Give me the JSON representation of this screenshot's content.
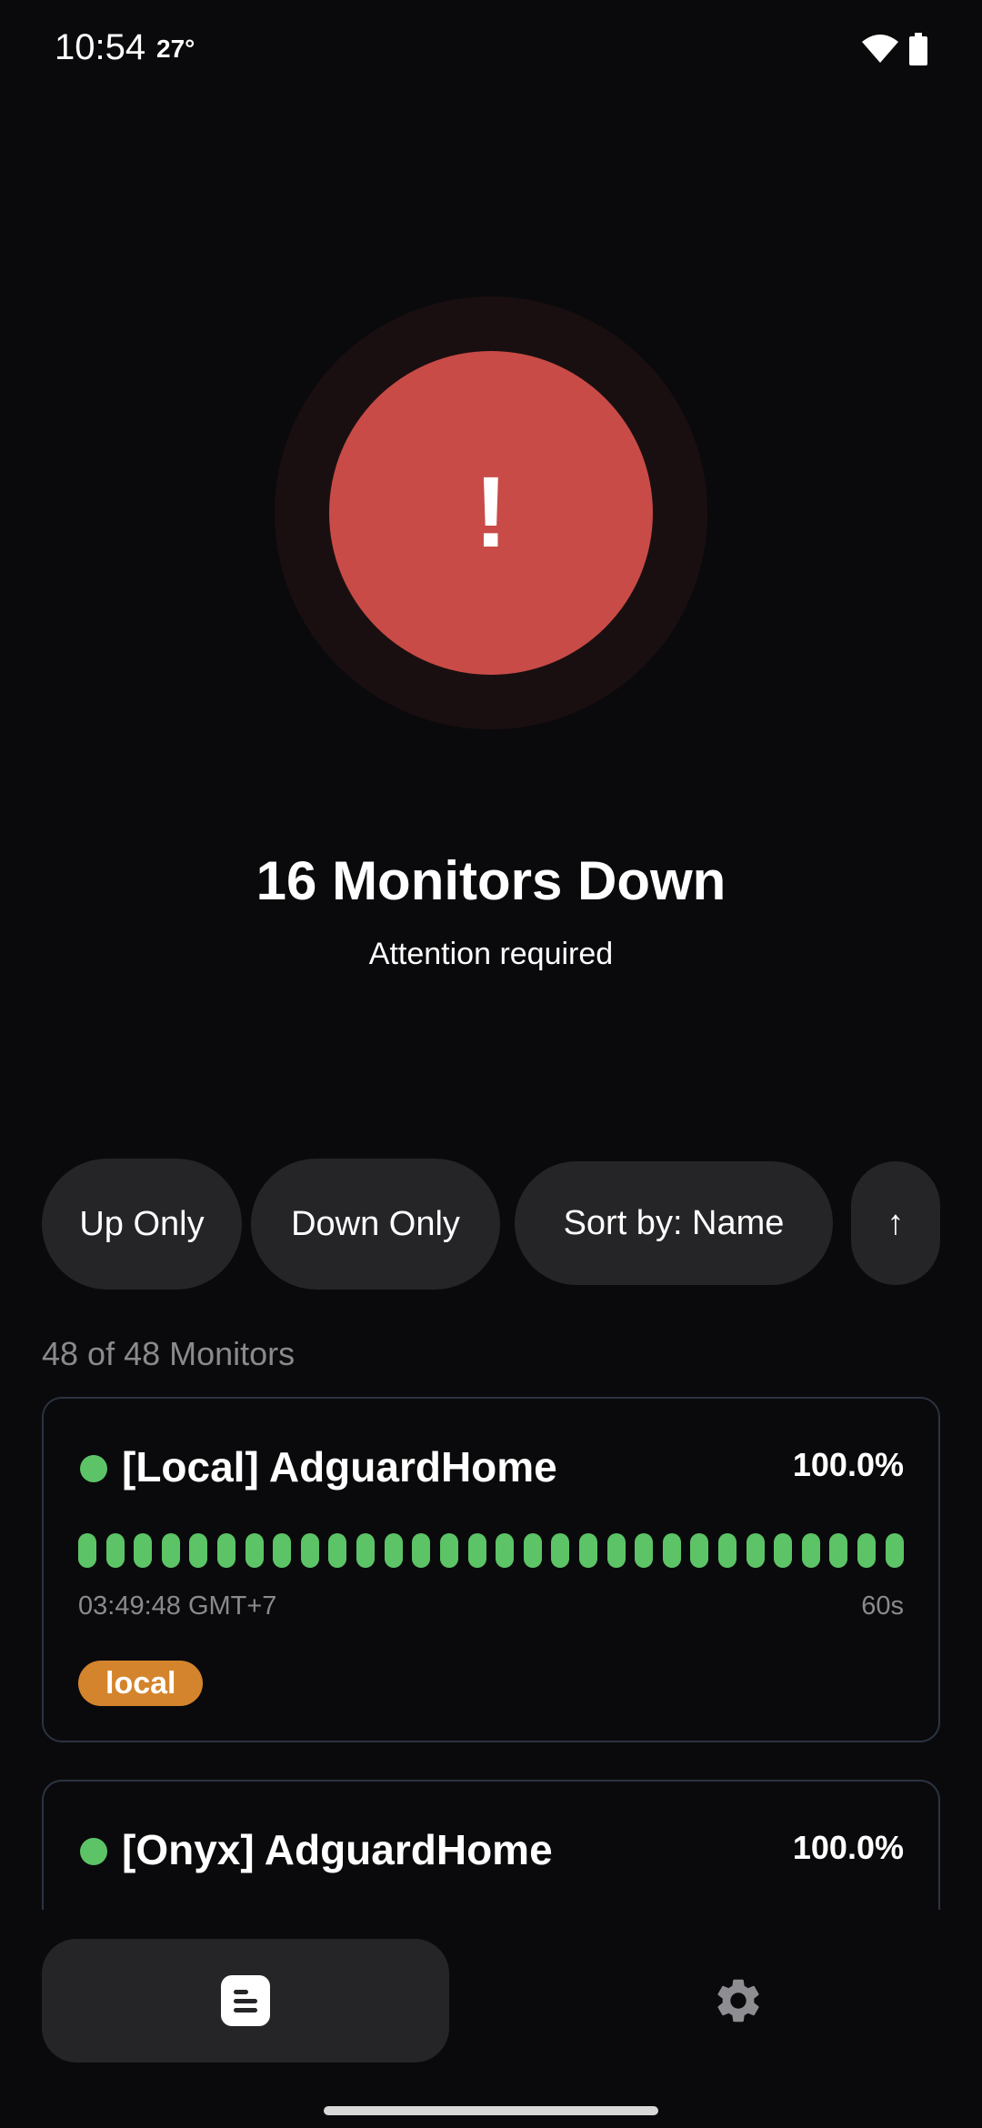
{
  "status_bar": {
    "time": "10:54",
    "temperature": "27°"
  },
  "hero": {
    "icon": "exclamation-icon",
    "symbol": "!",
    "title": "16 Monitors Down",
    "subtitle": "Attention required",
    "color_outer": "#1a0f10",
    "color_inner": "#c84b47"
  },
  "filters": {
    "up_only": "Up Only",
    "down_only": "Down Only",
    "sort": "Sort by: Name",
    "sort_direction": "↑"
  },
  "list": {
    "count_label": "48 of 48 Monitors",
    "monitors": [
      {
        "name": "[Local] AdguardHome",
        "uptime": "100.0%",
        "status": "up",
        "time": "03:49:48 GMT+7",
        "interval": "60s",
        "tag": "local",
        "tag_color": "#d4842c",
        "heartbeats": 30
      },
      {
        "name": "[Onyx] AdguardHome",
        "uptime": "100.0%",
        "status": "up"
      }
    ]
  },
  "nav": {
    "monitors_icon": "document-icon",
    "settings_icon": "gear-icon"
  },
  "colors": {
    "up": "#5cc466",
    "down": "#c84b47",
    "background": "#0a0a0c"
  }
}
